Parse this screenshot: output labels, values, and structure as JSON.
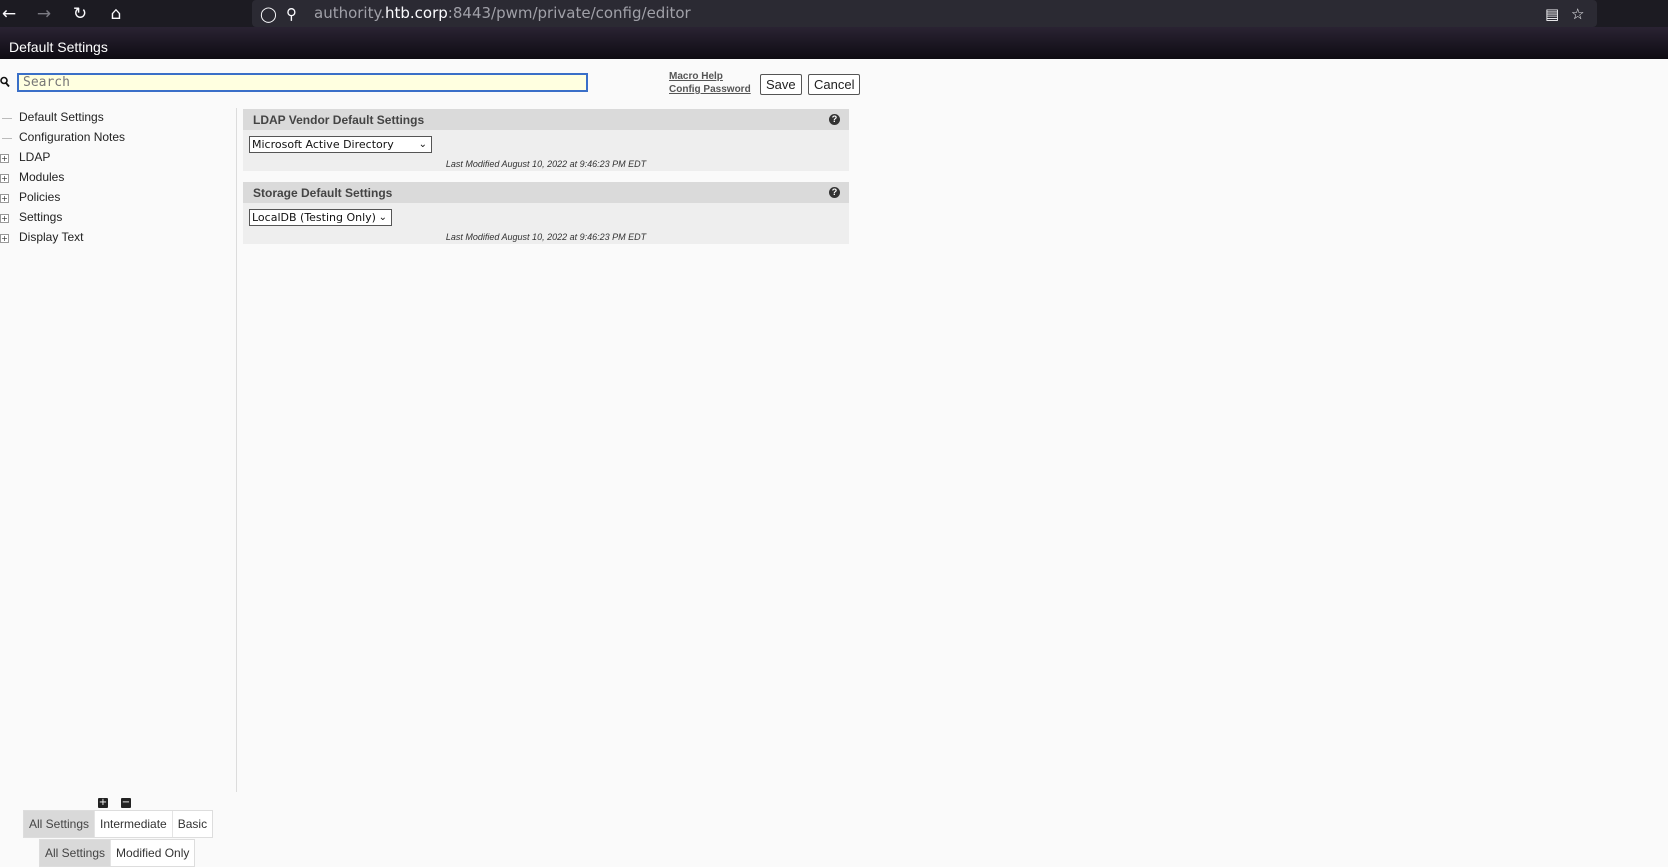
{
  "browser": {
    "url_host_prefix": "authority.",
    "url_host": "htb.corp",
    "url_rest": ":8443/pwm/private/config/editor"
  },
  "header": {
    "title": "Default Settings"
  },
  "search": {
    "placeholder": "Search"
  },
  "links": {
    "macro_help": "Macro Help",
    "config_password": "Config Password"
  },
  "actions": {
    "save": "Save",
    "cancel": "Cancel"
  },
  "sidebar": {
    "items": [
      {
        "label": "Default Settings",
        "expandable": false
      },
      {
        "label": "Configuration Notes",
        "expandable": false
      },
      {
        "label": "LDAP",
        "expandable": true
      },
      {
        "label": "Modules",
        "expandable": true
      },
      {
        "label": "Policies",
        "expandable": true
      },
      {
        "label": "Settings",
        "expandable": true
      },
      {
        "label": "Display Text",
        "expandable": true
      }
    ],
    "level_filter": {
      "options": [
        "All Settings",
        "Intermediate",
        "Basic"
      ],
      "selected": "All Settings"
    },
    "modified_filter": {
      "options": [
        "All Settings",
        "Modified Only"
      ],
      "selected": "All Settings"
    }
  },
  "panels": [
    {
      "title": "LDAP Vendor Default Settings",
      "selected": "Microsoft Active Directory",
      "last_modified": "Last Modified August 10, 2022 at 9:46:23 PM EDT"
    },
    {
      "title": "Storage Default Settings",
      "selected": "LocalDB (Testing Only)",
      "last_modified": "Last Modified August 10, 2022 at 9:46:23 PM EDT"
    }
  ]
}
